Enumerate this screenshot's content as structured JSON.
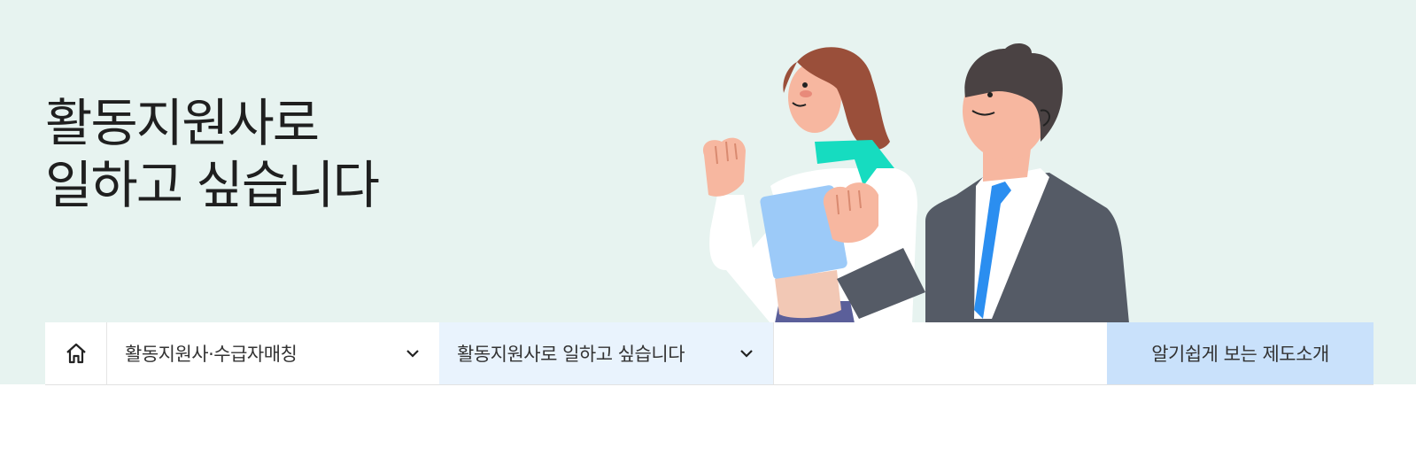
{
  "hero": {
    "title_line1": "활동지원사로",
    "title_line2": "일하고 싶습니다"
  },
  "nav": {
    "home_icon": "home-icon",
    "category_select": "활동지원사·수급자매칭",
    "page_select": "활동지원사로 일하고 싶습니다",
    "intro_button": "알기쉽게 보는 제도소개"
  },
  "colors": {
    "hero_bg": "#e7f3f0",
    "select_active_bg": "#e9f3fd",
    "intro_bg": "#c9e1fb"
  }
}
